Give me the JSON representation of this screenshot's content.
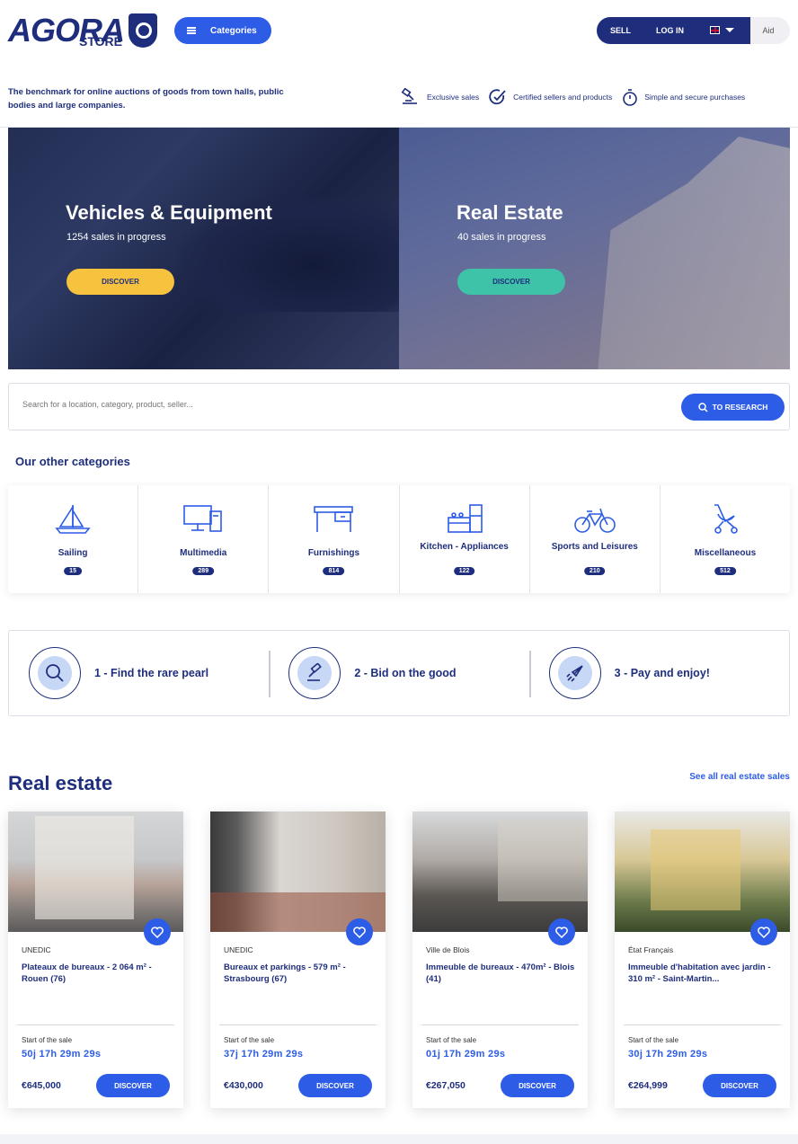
{
  "header": {
    "logo_main": "AGORA",
    "logo_sub": "STORE",
    "categories_label": "Categories",
    "sell_label": "SELL",
    "login_label": "LOG IN",
    "aid_label": "Aid",
    "tagline": "The benchmark for online auctions of goods from town halls, public bodies and large companies.",
    "features": [
      {
        "icon": "gavel-icon",
        "label": "Exclusive sales"
      },
      {
        "icon": "check-icon",
        "label": "Certified sellers and products"
      },
      {
        "icon": "stopwatch-icon",
        "label": "Simple and secure purchases"
      }
    ]
  },
  "hero": {
    "vehicles": {
      "title": "Vehicles & Equipment",
      "subtitle": "1254 sales in progress",
      "button": "DISCOVER"
    },
    "estate": {
      "title": "Real Estate",
      "subtitle": "40 sales in progress",
      "button": "DISCOVER"
    }
  },
  "search": {
    "placeholder": "Search for a location, category, product, seller...",
    "button": "TO RESEARCH"
  },
  "categories": {
    "heading": "Our other categories",
    "items": [
      {
        "label": "Sailing",
        "count": "15",
        "icon": "sailboat-icon"
      },
      {
        "label": "Multimedia",
        "count": "289",
        "icon": "computer-icon"
      },
      {
        "label": "Furnishings",
        "count": "814",
        "icon": "desk-icon"
      },
      {
        "label": "Kitchen - Appliances",
        "count": "122",
        "icon": "kitchen-icon"
      },
      {
        "label": "Sports and Leisures",
        "count": "210",
        "icon": "bicycle-icon"
      },
      {
        "label": "Miscellaneous",
        "count": "512",
        "icon": "stroller-icon"
      }
    ]
  },
  "steps": [
    {
      "label": "1 - Find the rare pearl",
      "icon": "magnifier-icon"
    },
    {
      "label": "2 - Bid on the good",
      "icon": "gavel-icon"
    },
    {
      "label": "3 - Pay and enjoy!",
      "icon": "rocket-icon"
    }
  ],
  "real_estate": {
    "heading": "Real estate",
    "see_all": "See all real estate sales",
    "cards": [
      {
        "seller": "UNEDIC",
        "title": "Plateaux de bureaux - 2 064 m² - Rouen (76)",
        "start_label": "Start of the sale",
        "timer": "50j  17h  29m  29s",
        "price": "€645,000",
        "button": "DISCOVER"
      },
      {
        "seller": "UNEDIC",
        "title": "Bureaux et parkings - 579 m² - Strasbourg (67)",
        "start_label": "Start of the sale",
        "timer": "37j  17h  29m  29s",
        "price": "€430,000",
        "button": "DISCOVER"
      },
      {
        "seller": "Ville de Blois",
        "title": "Immeuble de bureaux - 470m² - Blois (41)",
        "start_label": "Start of the sale",
        "timer": "01j  17h  29m  29s",
        "price": "€267,050",
        "button": "DISCOVER"
      },
      {
        "seller": "État Français",
        "title": "Immeuble d'habitation avec jardin - 310 m² - Saint-Martin...",
        "start_label": "Start of the sale",
        "timer": "30j  17h  29m  29s",
        "price": "€264,999",
        "button": "DISCOVER"
      }
    ]
  },
  "colors": {
    "primary": "#2d5ce6",
    "navy": "#1e2e7d",
    "yellow": "#f7c33e",
    "teal": "#3ec2a8"
  }
}
